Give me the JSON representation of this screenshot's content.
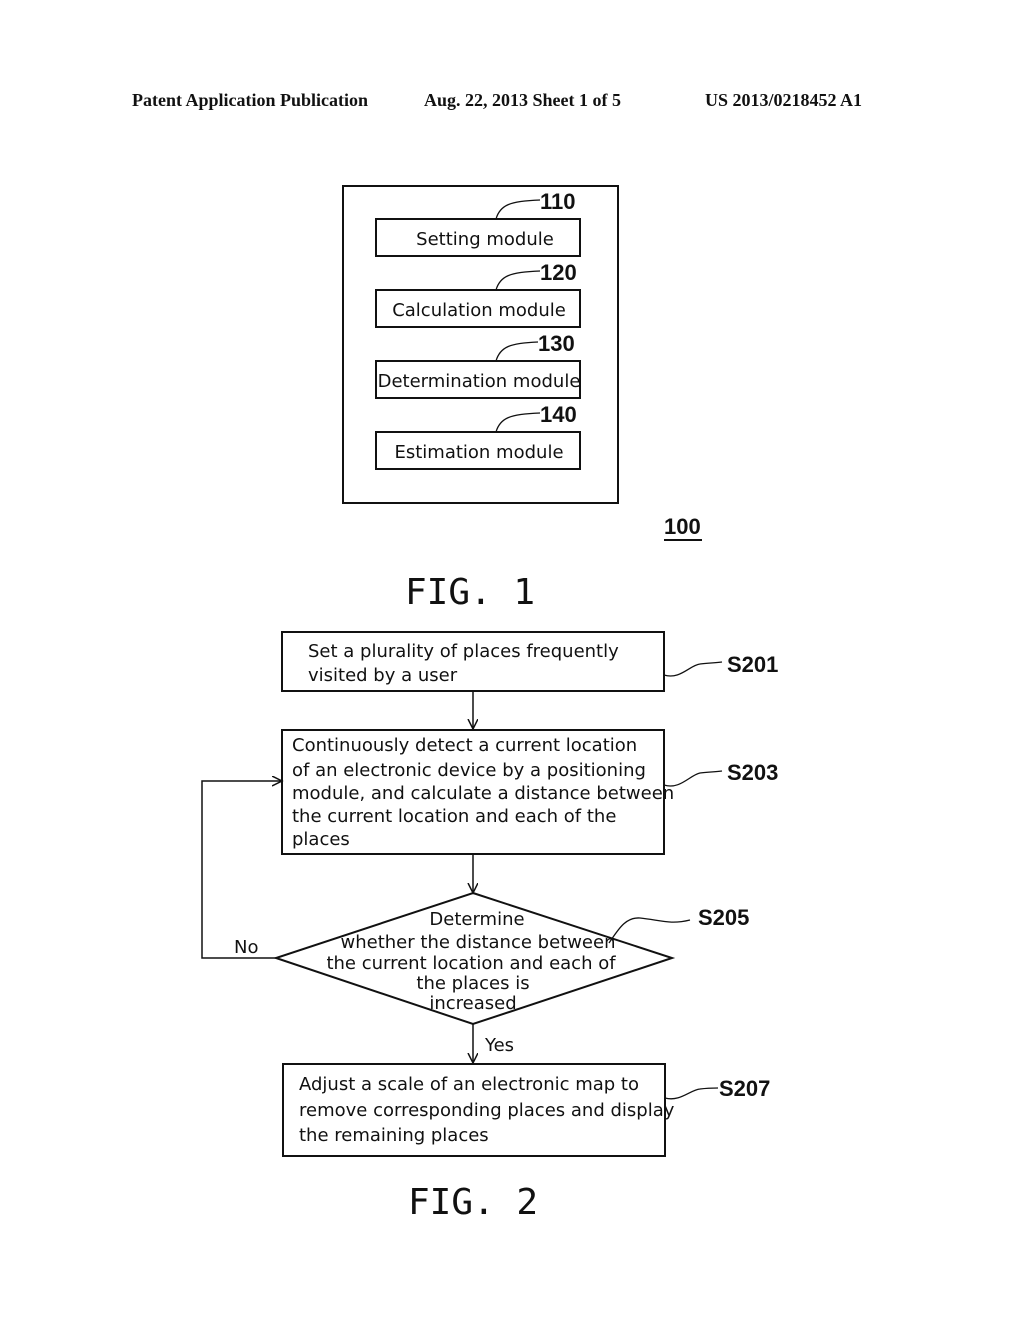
{
  "header": {
    "publication": "Patent Application Publication",
    "date_sheet": "Aug. 22, 2013  Sheet 1 of 5",
    "number": "US 2013/0218452 A1"
  },
  "fig1": {
    "caption": "FIG. 1",
    "system_ref": "100",
    "modules": [
      {
        "ref": "110",
        "label": "Setting module"
      },
      {
        "ref": "120",
        "label": "Calculation module"
      },
      {
        "ref": "130",
        "label": "Determination module"
      },
      {
        "ref": "140",
        "label": "Estimation module"
      }
    ]
  },
  "fig2": {
    "caption": "FIG. 2",
    "steps": [
      {
        "ref": "S201",
        "lines": [
          "Set a plurality of places frequently",
          "visited by a user"
        ]
      },
      {
        "ref": "S203",
        "lines": [
          "Continuously detect a current location",
          "of an electronic device by a positioning",
          "module, and calculate a distance between",
          "the current location and each of the",
          "places"
        ]
      },
      {
        "ref": "S205",
        "lines": [
          "Determine",
          "whether the distance between",
          "the current location and each of",
          "the places is",
          "increased"
        ]
      },
      {
        "ref": "S207",
        "lines": [
          "Adjust a scale of an electronic map to",
          "remove corresponding places and display",
          "the remaining places"
        ]
      }
    ],
    "branch_no": "No",
    "branch_yes": "Yes"
  }
}
